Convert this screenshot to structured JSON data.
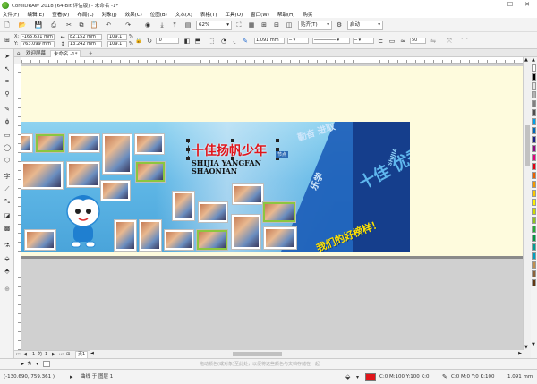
{
  "window": {
    "title": "CorelDRAW 2018 (64-Bit 评估版) - 未命名 -1*",
    "min": "─",
    "max": "☐",
    "close": "✕"
  },
  "menu": [
    "文件(F)",
    "编辑(E)",
    "查看(V)",
    "布局(L)",
    "对象(J)",
    "效果(C)",
    "位图(B)",
    "文本(X)",
    "表格(T)",
    "工具(O)",
    "窗口(W)",
    "帮助(H)",
    "购买"
  ],
  "toolbar": {
    "zoom": "62%",
    "snap": "贴齐(T)",
    "launch": "启动"
  },
  "props": {
    "x": "-165.631 mm",
    "y": "763.099 mm",
    "width": "82.152 mm",
    "height": "13.242 mm",
    "scale_x": "109.1",
    "scale_y": "109.1",
    "pct": "%",
    "rotation": ".0",
    "outline": "1.091 mm",
    "spin": "50"
  },
  "tabs": {
    "welcome": "欢迎屏幕",
    "doc": "未命名 -1*",
    "add": "+"
  },
  "banner": {
    "title_cn": "十佳扬帆少年",
    "title_py1": "SHIJIA YANGFAN",
    "title_py2": "SHAONIAN",
    "node_label": "节点",
    "slogan1": "勤奋 进取",
    "slogan2": "乐学",
    "big_chars": "十佳 优秀",
    "shijia": "SHIJIA",
    "bottom_slogan": "我们的好榜样！"
  },
  "pagenav": {
    "current": "1",
    "of": "的",
    "total": "1",
    "page_label": "页1"
  },
  "status": {
    "coords": "(-130.690, 759.361 )",
    "layer": "曲线 于 图层 1",
    "hint": "拖动颜色(或对象)至此处，以便将这些颜色与文档存储在一起",
    "fill": "C:0 M:100 Y:100 K:0",
    "outline": "C:0 M:0 Y:0 K:100",
    "outline_w": "1.091 mm"
  },
  "colors": {
    "accent": "#1c5db8",
    "fill": "#e0151b",
    "title_red": "#e0151b"
  },
  "palette": [
    "#ffffff",
    "#000000",
    "#e6e6e6",
    "#b3b3b3",
    "#808080",
    "#4d4d4d",
    "#00a0e9",
    "#0068b7",
    "#1d2088",
    "#920783",
    "#e4007f",
    "#e60012",
    "#eb6100",
    "#f39800",
    "#fcc800",
    "#fff100",
    "#cfdb00",
    "#8fc31f",
    "#22ac38",
    "#009944",
    "#009e96",
    "#00a0c1",
    "#c09050",
    "#8c6239",
    "#603813"
  ]
}
